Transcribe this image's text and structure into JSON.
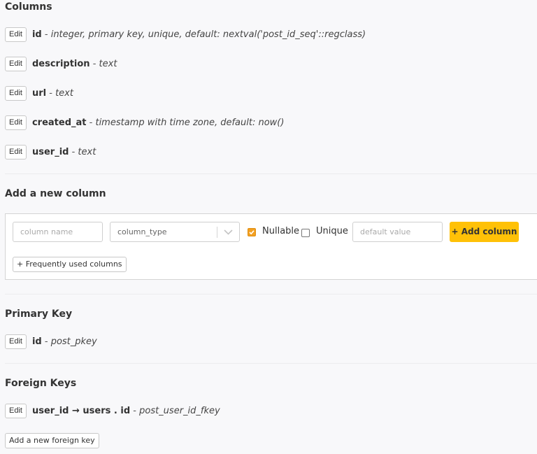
{
  "columns_section": {
    "title": "Columns",
    "edit_label": "Edit",
    "separator": " - ",
    "items": [
      {
        "name": "id",
        "detail": "integer, primary key, unique, default: nextval('post_id_seq'::regclass)"
      },
      {
        "name": "description",
        "detail": "text"
      },
      {
        "name": "url",
        "detail": "text"
      },
      {
        "name": "created_at",
        "detail": "timestamp with time zone, default: now()"
      },
      {
        "name": "user_id",
        "detail": "text"
      }
    ]
  },
  "add_column": {
    "title": "Add a new column",
    "name_placeholder": "column name",
    "type_placeholder": "column_type",
    "nullable_label": "Nullable",
    "nullable_checked": true,
    "unique_label": "Unique",
    "unique_checked": false,
    "default_placeholder": "default value",
    "submit_label": "+ Add column",
    "frequent_label": "+ Frequently used columns",
    "accent_color": "#ffc107",
    "checkbox_color": "#f2a022"
  },
  "primary_key": {
    "title": "Primary Key",
    "edit_label": "Edit",
    "column": "id",
    "separator": " - ",
    "constraint": "post_pkey"
  },
  "foreign_keys": {
    "title": "Foreign Keys",
    "edit_label": "Edit",
    "items": [
      {
        "column": "user_id",
        "arrow": " → ",
        "ref_table": "users",
        "dot": " . ",
        "ref_column": "id",
        "separator": " - ",
        "constraint": "post_user_id_fkey"
      }
    ],
    "add_label": "Add a new foreign key"
  }
}
